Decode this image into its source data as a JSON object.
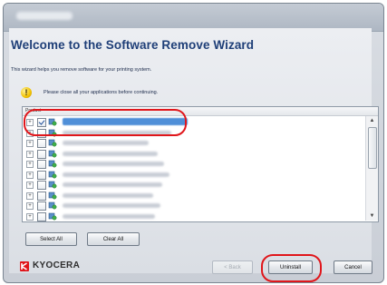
{
  "window": {
    "title": ""
  },
  "wizard": {
    "title": "Welcome to the Software Remove Wizard",
    "description": "This wizard helps you remove software for your printing system.",
    "warning": "Please close all your applications before continuing."
  },
  "product_list": {
    "header": "Product",
    "rows": [
      {
        "checked": true,
        "selected": true
      },
      {
        "checked": false,
        "selected": false
      },
      {
        "checked": false,
        "selected": false
      },
      {
        "checked": false,
        "selected": false
      },
      {
        "checked": false,
        "selected": false
      },
      {
        "checked": false,
        "selected": false
      },
      {
        "checked": false,
        "selected": false
      },
      {
        "checked": false,
        "selected": false
      },
      {
        "checked": false,
        "selected": false
      },
      {
        "checked": false,
        "selected": false
      }
    ]
  },
  "buttons": {
    "select_all": "Select All",
    "clear_all": "Clear All",
    "back": "< Back",
    "uninstall": "Uninstall",
    "cancel": "Cancel"
  },
  "brand": {
    "name": "KYOCERA",
    "logo_color": "#e0161b"
  },
  "colors": {
    "title": "#1f3f78",
    "highlight": "#e0161b",
    "selection": "#4f8fd8"
  }
}
